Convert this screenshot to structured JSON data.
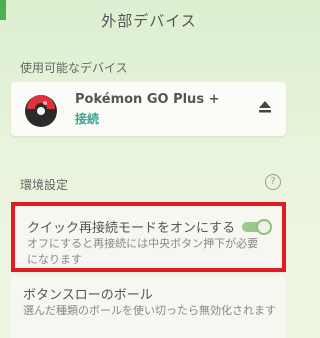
{
  "header": {
    "title": "外部デバイス"
  },
  "devices": {
    "section_label": "使用可能なデバイス",
    "card": {
      "name": "Pokémon GO Plus +",
      "status": "接続"
    }
  },
  "settings": {
    "section_label": "環境設定",
    "help_symbol": "?",
    "items": [
      {
        "title": "クイック再接続モードをオンにする",
        "description": "オフにすると再接続には中央ボタン押下が必要になります",
        "toggle_on": true
      },
      {
        "title": "ボタンスローのボール",
        "description": "選んだ種類のボールを使い切ったら無効化されます"
      }
    ]
  },
  "colors": {
    "status_green": "#3ba58f",
    "highlight_red": "#e01b24",
    "toggle_green": "#9cc88b"
  }
}
